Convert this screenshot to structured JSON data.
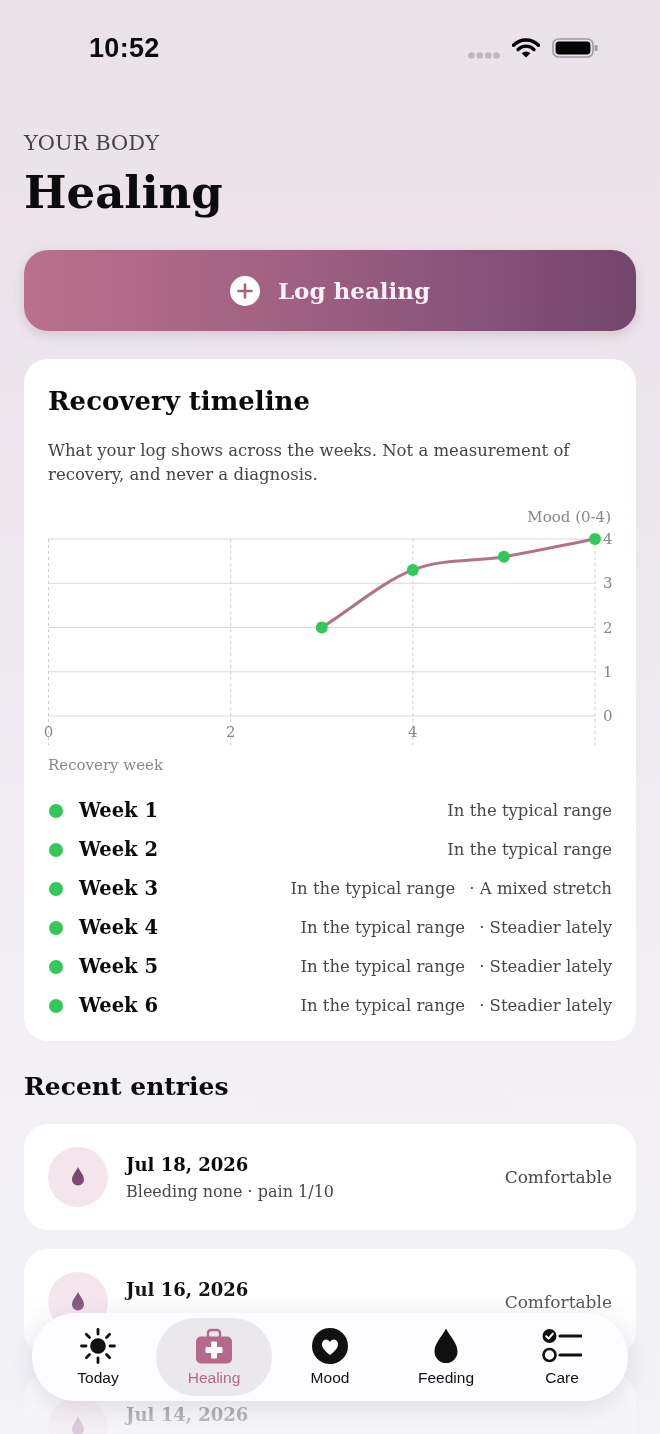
{
  "status_bar": {
    "time": "10:52"
  },
  "header": {
    "eyebrow": "YOUR BODY",
    "title": "Healing"
  },
  "log_button": {
    "label": "Log healing"
  },
  "timeline": {
    "title": "Recovery timeline",
    "description": "What your log shows across the weeks. Not a measurement of recovery, and never a diagnosis.",
    "chart_data": {
      "type": "line",
      "xlabel": "Recovery week",
      "ylabel": "Mood (0-4)",
      "x": [
        3,
        4,
        5,
        6
      ],
      "series": [
        {
          "color": "#b5708a",
          "values": [
            2,
            3.3,
            3.6,
            4
          ],
          "marker": true
        }
      ],
      "xlim": [
        0,
        6
      ],
      "ylim": [
        0,
        4
      ],
      "xticks": [
        0,
        2,
        4
      ],
      "yticks": [
        0,
        1,
        2,
        3,
        4
      ],
      "grid": true
    },
    "weeks": [
      {
        "label": "Week 1",
        "status": "In the typical range",
        "color": "#34c759"
      },
      {
        "label": "Week 2",
        "status": "In the typical range",
        "color": "#34c759"
      },
      {
        "label": "Week 3",
        "status": "In the typical range",
        "note": "· A mixed stretch",
        "color": "#34c759"
      },
      {
        "label": "Week 4",
        "status": "In the typical range",
        "note": "· Steadier lately",
        "color": "#34c759"
      },
      {
        "label": "Week 5",
        "status": "In the typical range",
        "note": "· Steadier lately",
        "color": "#34c759"
      },
      {
        "label": "Week 6",
        "status": "In the typical range",
        "note": "· Steadier lately",
        "color": "#34c759"
      }
    ]
  },
  "recent": {
    "title": "Recent entries",
    "entries": [
      {
        "date": "Jul 18, 2026",
        "detail": "Bleeding none · pain 1/10",
        "feeling": "Comfortable"
      },
      {
        "date": "Jul 16, 2026",
        "feeling": "Comfortable"
      },
      {
        "date": "Jul 14, 2026"
      }
    ]
  },
  "tabs": [
    {
      "label": "Today",
      "selected": false
    },
    {
      "label": "Healing",
      "selected": true
    },
    {
      "label": "Mood",
      "selected": false
    },
    {
      "label": "Feeding",
      "selected": false
    },
    {
      "label": "Care",
      "selected": false
    }
  ]
}
